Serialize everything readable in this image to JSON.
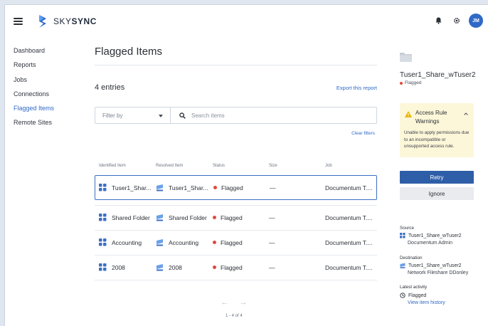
{
  "header": {
    "brand_light": "SKY",
    "brand_bold": "SYNC",
    "avatar_initials": "JM",
    "icons": [
      "menu-icon",
      "bell-icon",
      "gear-icon"
    ]
  },
  "sidebar": {
    "items": [
      {
        "label": "Dashboard"
      },
      {
        "label": "Reports"
      },
      {
        "label": "Jobs"
      },
      {
        "label": "Connections"
      },
      {
        "label": "Flagged Items",
        "active": true
      },
      {
        "label": "Remote Sites"
      }
    ]
  },
  "main": {
    "title": "Flagged Items",
    "entries": "4 entries",
    "export_label": "Export this report",
    "filter_label": "Filter by",
    "search_placeholder": "Search items",
    "clear_filters": "Clear filters",
    "columns": [
      "Identified Item",
      "Resolved Item",
      "Status",
      "Size",
      "Job"
    ],
    "rows": [
      {
        "identified": "Tuser1_Shar...",
        "resolved": "Tuser1_Shar...",
        "status": "Flagged",
        "size": "—",
        "job": "Documentum T...."
      },
      {
        "identified": "Shared Folder",
        "resolved": "Shared Folder",
        "status": "Flagged",
        "size": "—",
        "job": "Documentum T...."
      },
      {
        "identified": "Accounting",
        "resolved": "Accounting",
        "status": "Flagged",
        "size": "—",
        "job": "Documentum T...."
      },
      {
        "identified": "2008",
        "resolved": "2008",
        "status": "Flagged",
        "size": "—",
        "job": "Documentum T...."
      }
    ],
    "pager_prev": "←",
    "pager_next": "→",
    "pager_count": "1 - 4 of 4"
  },
  "detail": {
    "title": "Tuser1_Share_wTuser2",
    "status": "Flagged",
    "warning_title": "Access Rule Warnings",
    "warning_text": "Unable to apply permissions due to an incompatible or unsupported access rule.",
    "retry_label": "Retry",
    "ignore_label": "Ignore",
    "source_label": "Source",
    "source_name": "Tuser1_Share_wTuser2",
    "source_conn": "Documentum Admin",
    "destination_label": "Destination",
    "destination_name": "Tuser1_Share_wTuser2",
    "destination_conn": "Network Fileshare DDonley",
    "activity_label": "Latest activity",
    "activity_status": "Flagged",
    "history_link": "View item history"
  },
  "colors": {
    "accent": "#2f69c7",
    "flag_dot": "#e0483e",
    "retry_bg": "#2f5ea8",
    "warning_bg": "#fdf7d9"
  }
}
